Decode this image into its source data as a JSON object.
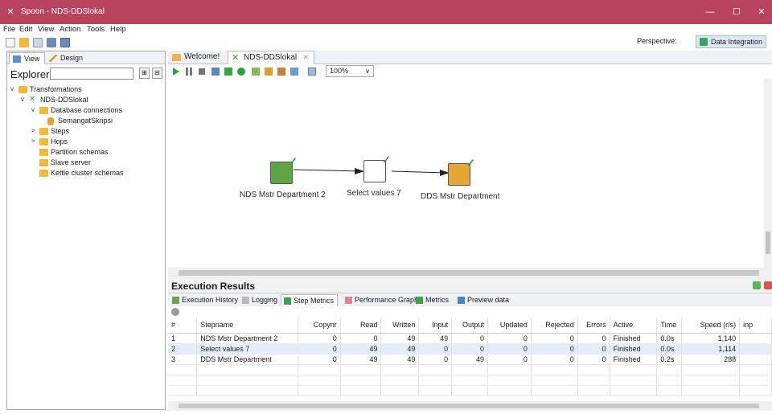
{
  "window": {
    "title": "Spoon - NDS-DDSlokal",
    "minimize": "—",
    "maximize": "☐",
    "close": "✕"
  },
  "menu": [
    "File",
    "Edit",
    "View",
    "Action",
    "Tools",
    "Help"
  ],
  "perspective": {
    "label": "Perspective:",
    "value": "Data Integration"
  },
  "left_tabs": [
    "View",
    "Design"
  ],
  "explorer": {
    "label": "Explorer",
    "search_value": ""
  },
  "tree": [
    {
      "label": "Transformations",
      "arrow": "v"
    },
    {
      "label": "NDS-DDSlokal",
      "arrow": "v"
    },
    {
      "label": "Database connections",
      "arrow": "v"
    },
    {
      "label": "SemangatSkripsi",
      "arrow": ""
    },
    {
      "label": "Steps",
      "arrow": ">"
    },
    {
      "label": "Hops",
      "arrow": ">"
    },
    {
      "label": "Partition schemas",
      "arrow": ""
    },
    {
      "label": "Slave server",
      "arrow": ""
    },
    {
      "label": "Kettle cluster schemas",
      "arrow": ""
    }
  ],
  "editor_tabs": [
    {
      "label": "Welcome!"
    },
    {
      "label": "NDS-DDSlokal",
      "close": "✕"
    }
  ],
  "zoom": "100%",
  "steps": [
    {
      "label": "NDS Mstr Department 2"
    },
    {
      "label": "Select values 7"
    },
    {
      "label": "DDS Mstr Department"
    }
  ],
  "results": {
    "title": "Execution Results",
    "tabs": [
      "Execution History",
      "Logging",
      "Step Metrics",
      "Performance Graph",
      "Metrics",
      "Preview data"
    ],
    "columns": [
      "#",
      "Stepname",
      "Copynr",
      "Read",
      "Written",
      "Input",
      "Output",
      "Updated",
      "Rejected",
      "Errors",
      "Active",
      "Time",
      "Speed (r/s)",
      "inp"
    ],
    "rows": [
      [
        "1",
        "NDS Mstr Department 2",
        "0",
        "0",
        "49",
        "49",
        "0",
        "0",
        "0",
        "0",
        "Finished",
        "0.0s",
        "1,140",
        ""
      ],
      [
        "2",
        "Select values 7",
        "0",
        "49",
        "49",
        "0",
        "0",
        "0",
        "0",
        "0",
        "Finished",
        "0.0s",
        "1,114",
        ""
      ],
      [
        "3",
        "DDS Mstr Department",
        "0",
        "49",
        "49",
        "0",
        "49",
        "0",
        "0",
        "0",
        "Finished",
        "0.2s",
        "288",
        ""
      ]
    ]
  },
  "colors": {
    "titlebar": "#b8435e",
    "folder": "#f2b83a",
    "run_green": "#2f9e3f",
    "selected_row": "#e4eef9"
  }
}
